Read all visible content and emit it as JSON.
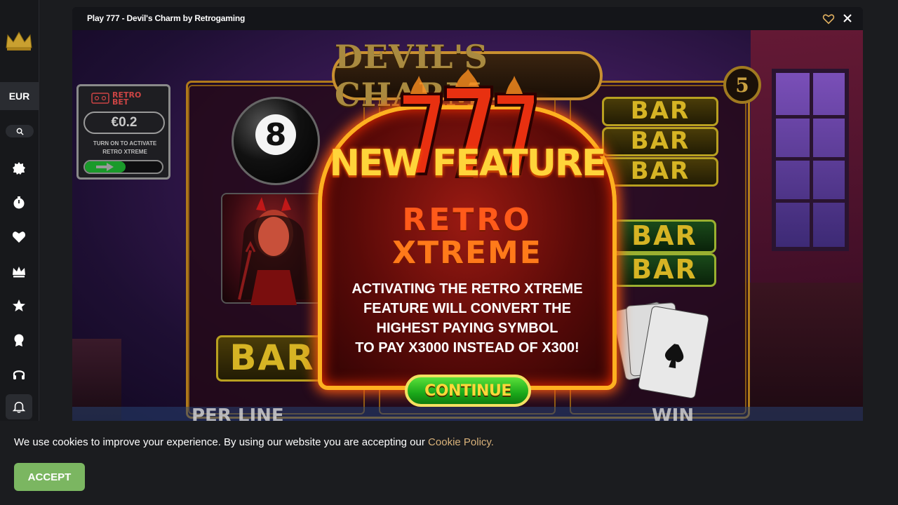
{
  "sidebar": {
    "logo_icon": "crown-logo-icon",
    "currency": "EUR",
    "search_icon": "search-icon",
    "items": [
      {
        "icon": "new-badge-icon"
      },
      {
        "icon": "stopwatch-icon"
      },
      {
        "icon": "heart-icon"
      },
      {
        "icon": "crown-icon"
      },
      {
        "icon": "star-icon"
      },
      {
        "icon": "award-icon"
      },
      {
        "icon": "headset-icon"
      },
      {
        "icon": "bell-icon"
      }
    ]
  },
  "game_window": {
    "title": "Play 777 - Devil's Charm by Retrogaming",
    "favorite_icon": "heart-outline-icon",
    "close_icon": "close-icon"
  },
  "game": {
    "title_plaque": "DEVIL'S CHARM",
    "lines_count": "5",
    "retro_bet": {
      "logo_line1": "RETRO",
      "logo_line2": "BET",
      "value": "€0.2",
      "hint_line1": "TURN ON TO ACTIVATE",
      "hint_line2": "RETRO XTREME"
    },
    "symbols": {
      "ball_number": "8",
      "bar": "BAR"
    },
    "bottom_labels": {
      "left": "PER LINE",
      "right": "WIN"
    },
    "modal": {
      "sevens": "777",
      "heading": "NEW FEATURE",
      "feature_line1": "RETRO",
      "feature_line2": "XTREME",
      "body_line1": "ACTIVATING THE RETRO XTREME",
      "body_line2": "FEATURE WILL CONVERT THE",
      "body_line3": "HIGHEST PAYING SYMBOL",
      "body_line4": "TO PAY X3000 INSTEAD OF X300!",
      "continue_label": "CONTINUE"
    }
  },
  "cookie": {
    "text": "We use cookies to improve your experience. By using our website you are accepting our ",
    "link": "Cookie Policy.",
    "accept_label": "ACCEPT"
  },
  "colors": {
    "page_bg": "#1b1c1f",
    "accent_green": "#7bb661",
    "link": "#d9b27a",
    "gold": "#ffb020"
  }
}
